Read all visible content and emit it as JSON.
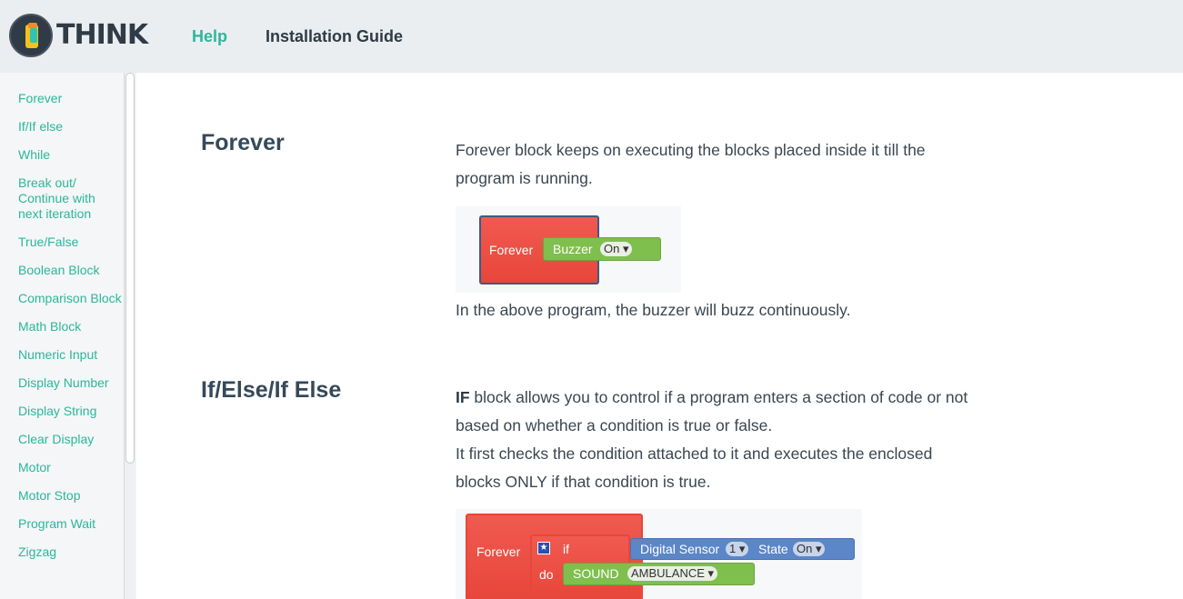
{
  "header": {
    "logo_text": "THINK",
    "nav": [
      {
        "label": "Help"
      },
      {
        "label": "Installation Guide"
      }
    ]
  },
  "sidebar": {
    "items": [
      {
        "label": "Forever"
      },
      {
        "label": "If/If else"
      },
      {
        "label": "While"
      },
      {
        "label": "Break out/ Continue with next iteration"
      },
      {
        "label": "True/False"
      },
      {
        "label": "Boolean Block"
      },
      {
        "label": "Comparison Block"
      },
      {
        "label": "Math Block"
      },
      {
        "label": "Numeric Input"
      },
      {
        "label": "Display Number"
      },
      {
        "label": "Display String"
      },
      {
        "label": "Clear Display"
      },
      {
        "label": "Motor"
      },
      {
        "label": "Motor Stop"
      },
      {
        "label": "Program Wait"
      },
      {
        "label": "Zigzag"
      }
    ]
  },
  "sections": {
    "forever": {
      "title": "Forever",
      "desc": "Forever block keeps on executing the blocks placed inside it till the program is running.",
      "caption": "In the above program, the buzzer will buzz continuously.",
      "block": {
        "forever": "Forever",
        "buzzer": "Buzzer",
        "buzzer_state": "On"
      }
    },
    "if": {
      "title": "If/Else/If Else",
      "desc_bold": "IF",
      "desc_rest": " block allows you to control if a program enters a section of code or not based on whether a condition is true or false.",
      "desc2": "It first checks the condition attached to it and executes the enclosed blocks ONLY if that condition is true.",
      "block": {
        "forever": "Forever",
        "if": "if",
        "do": "do",
        "digital_sensor": "Digital Sensor",
        "sensor_num": "1",
        "state": "State",
        "state_val": "On",
        "sound": "SOUND",
        "sound_val": "AMBULANCE"
      }
    }
  }
}
